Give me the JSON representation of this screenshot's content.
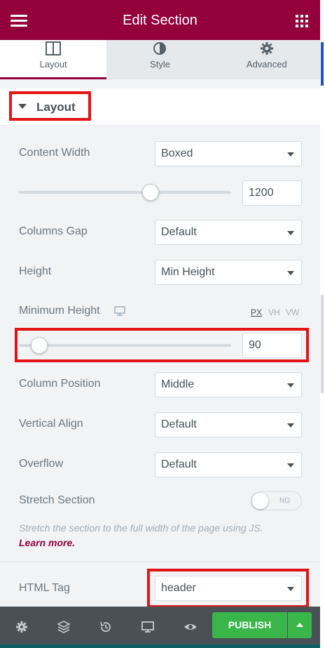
{
  "header": {
    "title": "Edit Section"
  },
  "tabs": [
    {
      "label": "Layout",
      "icon": "layout-icon",
      "active": true
    },
    {
      "label": "Style",
      "icon": "contrast-icon",
      "active": false
    },
    {
      "label": "Advanced",
      "icon": "gear-icon",
      "active": false
    }
  ],
  "section": {
    "title": "Layout"
  },
  "controls": {
    "content_width": {
      "label": "Content Width",
      "value": "Boxed"
    },
    "width_slider": {
      "value": "1200",
      "fraction": 0.63
    },
    "columns_gap": {
      "label": "Columns Gap",
      "value": "Default"
    },
    "height": {
      "label": "Height",
      "value": "Min Height"
    },
    "min_height": {
      "label": "Minimum Height",
      "units": [
        "PX",
        "VH",
        "VW"
      ],
      "active_unit": "PX",
      "value": "90",
      "fraction": 0.06
    },
    "column_position": {
      "label": "Column Position",
      "value": "Middle"
    },
    "vertical_align": {
      "label": "Vertical Align",
      "value": "Default"
    },
    "overflow": {
      "label": "Overflow",
      "value": "Default"
    },
    "stretch": {
      "label": "Stretch Section",
      "toggle": "NO",
      "description": "Stretch the section to the full width of the page using JS.",
      "learn_more": "Learn more."
    },
    "html_tag": {
      "label": "HTML Tag",
      "value": "header"
    }
  },
  "footer": {
    "publish": "PUBLISH"
  },
  "colors": {
    "brand": "#93003c",
    "publish": "#39b54a",
    "highlight": "#e31414",
    "footer": "#495157"
  }
}
